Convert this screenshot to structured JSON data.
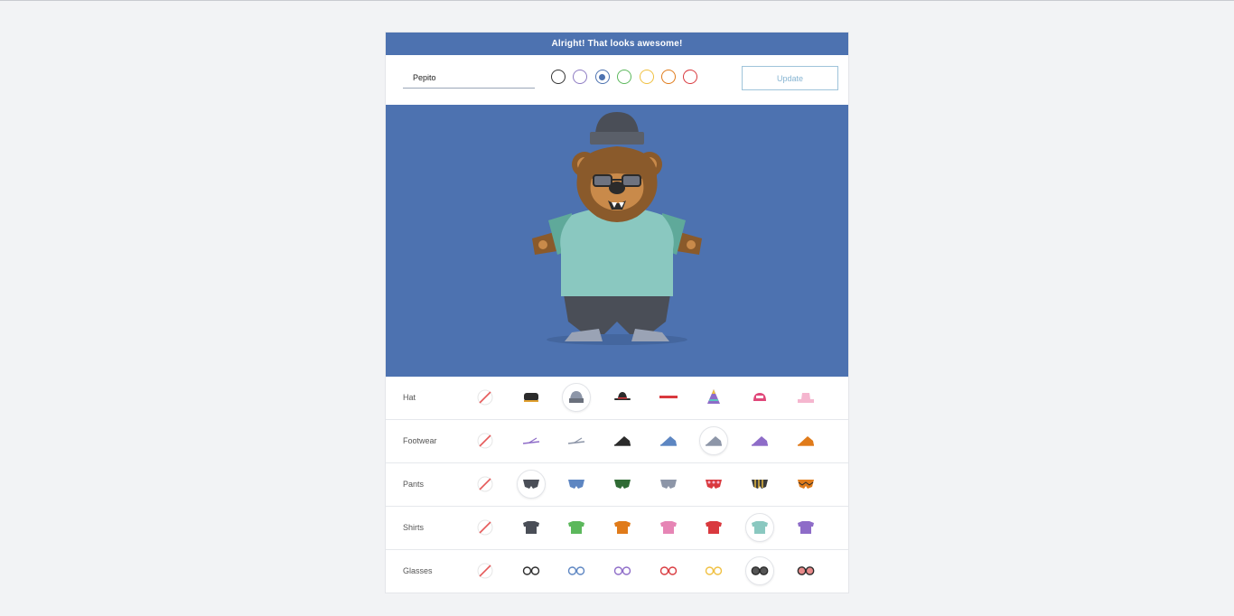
{
  "banner": {
    "text": "Alright! That looks awesome!"
  },
  "name_input": {
    "value": "Pepito",
    "placeholder": ""
  },
  "update_button": {
    "label": "Update"
  },
  "accent": "#4d72b0",
  "colors": [
    {
      "name": "black",
      "hex": "#333333",
      "selected": false
    },
    {
      "name": "purple",
      "hex": "#8e7cc3",
      "selected": false
    },
    {
      "name": "blue",
      "hex": "#4d72b0",
      "selected": true
    },
    {
      "name": "green",
      "hex": "#5cb85c",
      "selected": false
    },
    {
      "name": "yellow",
      "hex": "#f0c040",
      "selected": false
    },
    {
      "name": "orange",
      "hex": "#e07b1a",
      "selected": false
    },
    {
      "name": "red",
      "hex": "#d9393e",
      "selected": false
    }
  ],
  "categories": [
    {
      "label": "Hat",
      "selected": 2,
      "items": [
        "none-icon",
        "cap-black-icon",
        "beanie-gray-icon",
        "bowler-hat-icon",
        "headband-red-icon",
        "party-hat-icon",
        "trucker-cap-pink-icon",
        "bucket-hat-pink-icon"
      ]
    },
    {
      "label": "Footwear",
      "selected": 5,
      "items": [
        "none-icon",
        "flip-flops-purple-icon",
        "flip-flops-gray-icon",
        "sneaker-black-icon",
        "sneaker-blue-icon",
        "sneaker-gray-icon",
        "sneaker-purple-icon",
        "sneaker-orange-icon"
      ]
    },
    {
      "label": "Pants",
      "selected": 1,
      "items": [
        "none-icon",
        "pants-charcoal-icon",
        "pants-blue-icon",
        "pants-green-icon",
        "pants-gray-icon",
        "pants-pink-pattern-icon",
        "pants-striped-icon",
        "pants-orange-pattern-icon"
      ]
    },
    {
      "label": "Shirts",
      "selected": 6,
      "items": [
        "none-icon",
        "shirt-charcoal-icon",
        "shirt-green-icon",
        "shirt-orange-icon",
        "shirt-pink-icon",
        "shirt-red-icon",
        "shirt-teal-icon",
        "shirt-purple-icon"
      ]
    },
    {
      "label": "Glasses",
      "selected": 6,
      "items": [
        "none-icon",
        "glasses-black-icon",
        "glasses-blue-icon",
        "glasses-purple-icon",
        "glasses-red-icon",
        "glasses-yellow-icon",
        "sunglasses-gray-icon",
        "sunglasses-pink-icon"
      ]
    }
  ]
}
